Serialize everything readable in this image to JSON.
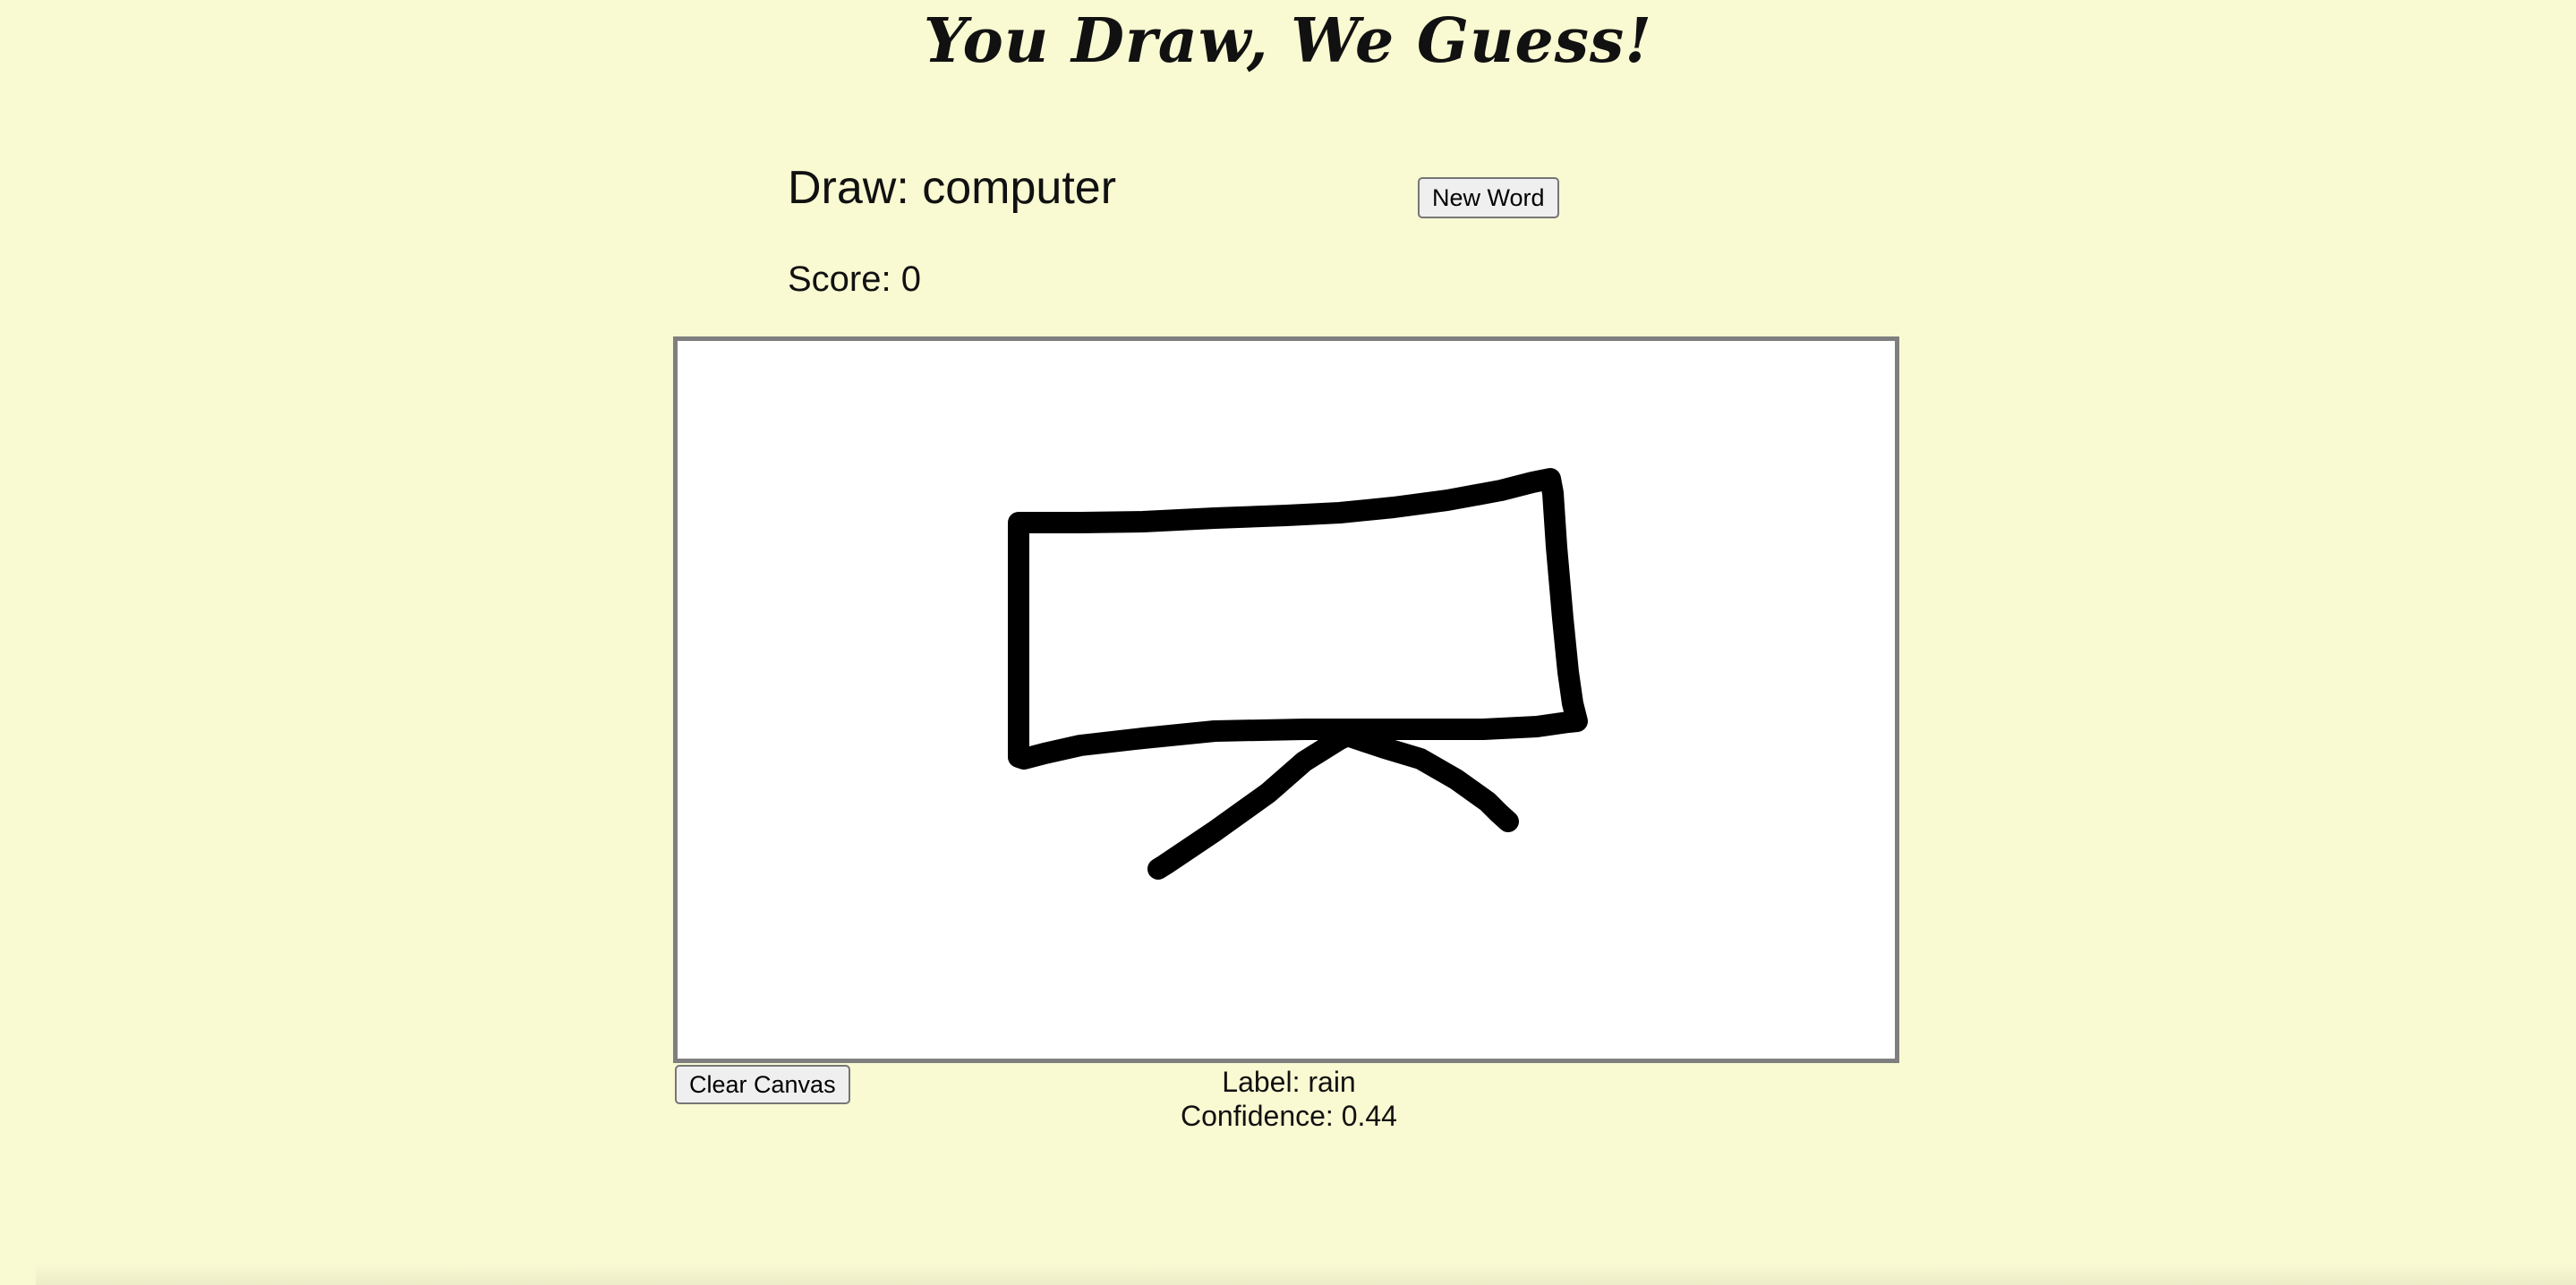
{
  "app": {
    "title": "You Draw, We Guess!"
  },
  "game": {
    "draw_label": "Draw:",
    "word": "computer",
    "new_word_label": "New Word",
    "score_label": "Score:",
    "score": "0"
  },
  "canvas": {
    "background": "#ffffff",
    "border_color": "#7f7f7f",
    "stroke_color": "#000000",
    "clear_label": "Clear Canvas"
  },
  "prediction": {
    "label_prefix": "Label:",
    "label": "rain",
    "confidence_prefix": "Confidence:",
    "confidence": "0.44"
  },
  "theme": {
    "page_background": "#f9f9d2"
  }
}
